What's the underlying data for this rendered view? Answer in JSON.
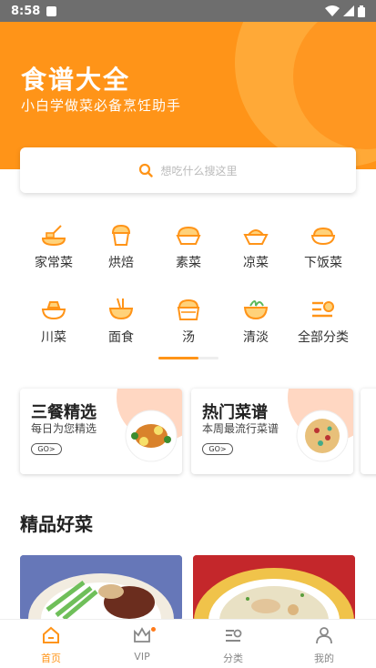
{
  "status_bar": {
    "time": "8:58"
  },
  "hero": {
    "title": "食谱大全",
    "subtitle": "小白学做菜必备烹饪助手"
  },
  "search": {
    "placeholder": "想吃什么搜这里",
    "icon": "search-icon"
  },
  "categories": [
    {
      "label": "家常菜",
      "icon": "home-dish-icon"
    },
    {
      "label": "烘焙",
      "icon": "baking-icon"
    },
    {
      "label": "素菜",
      "icon": "vegetable-dish-icon"
    },
    {
      "label": "凉菜",
      "icon": "cold-dish-icon"
    },
    {
      "label": "下饭菜",
      "icon": "rice-dish-icon"
    },
    {
      "label": "川菜",
      "icon": "sichuan-dish-icon"
    },
    {
      "label": "面食",
      "icon": "noodles-icon"
    },
    {
      "label": "汤",
      "icon": "soup-icon"
    },
    {
      "label": "清淡",
      "icon": "light-dish-icon"
    },
    {
      "label": "全部分类",
      "icon": "all-categories-icon"
    }
  ],
  "feature_cards": [
    {
      "title": "三餐精选",
      "subtitle": "每日为您精选",
      "go_label": "GO>"
    },
    {
      "title": "热门菜谱",
      "subtitle": "本周最流行菜谱",
      "go_label": "GO>"
    }
  ],
  "section": {
    "title": "精品好菜"
  },
  "colors": {
    "accent": "#ff9418",
    "accent_light": "#ffb042",
    "card_blob": "#ffd7c2"
  },
  "tab_bar": {
    "tabs": [
      {
        "label": "首页",
        "icon": "home-icon",
        "active": true
      },
      {
        "label": "VIP",
        "icon": "crown-icon",
        "active": false
      },
      {
        "label": "分类",
        "icon": "category-list-icon",
        "active": false
      },
      {
        "label": "我的",
        "icon": "profile-icon",
        "active": false
      }
    ]
  }
}
